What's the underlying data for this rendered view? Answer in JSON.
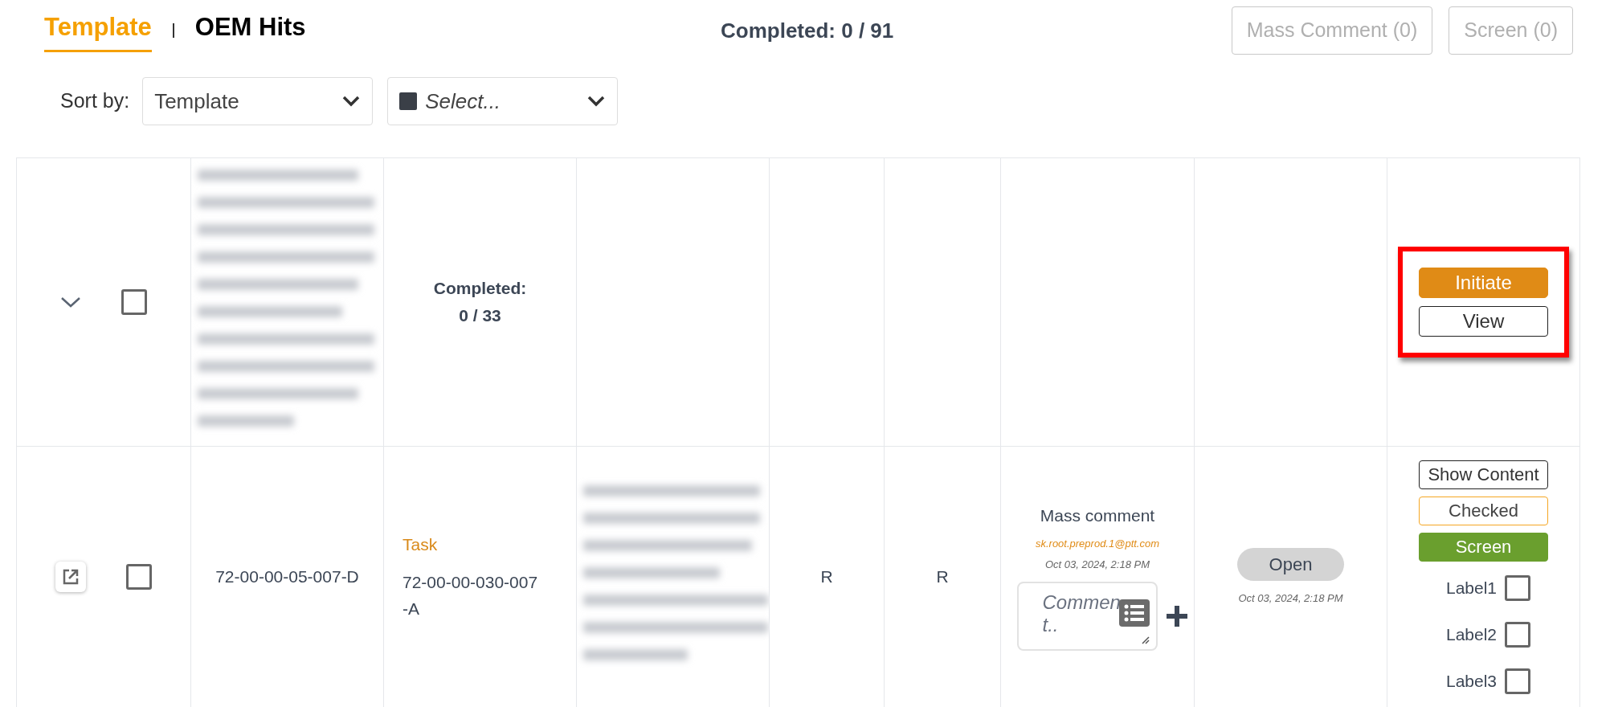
{
  "header": {
    "tabs": [
      {
        "label": "Template",
        "selected": true
      },
      {
        "label": "OEM Hits",
        "selected": false
      }
    ],
    "completed": "Completed: 0 / 91",
    "buttons": [
      {
        "label": "Mass Comment (0)",
        "disabled": true
      },
      {
        "label": "Screen (0)",
        "disabled": true
      }
    ]
  },
  "sort": {
    "label": "Sort by:",
    "selects": [
      {
        "kind": "value",
        "text": "Template"
      },
      {
        "kind": "placeholder",
        "text": "Select..."
      }
    ]
  },
  "rows": [
    {
      "kind": "group",
      "checked": false,
      "completed_label": "Completed:",
      "completed_value": "0 / 33",
      "highlighted": true,
      "actions": [
        {
          "label": "Initiate",
          "kind": "primary"
        },
        {
          "label": "View",
          "kind": "outline"
        }
      ]
    },
    {
      "kind": "task",
      "checked": false,
      "column_2": "72-00-00-05-007-D",
      "type": "Task",
      "number": "72-00-00-030-007-A",
      "column_5": "R",
      "column_6": "R",
      "comment": {
        "title": "Mass comment",
        "author": "sk.root.preprod.1@ptt.com",
        "date": "Oct 03, 2024, 2:18 PM",
        "placeholder": "Comment.."
      },
      "status": {
        "label": "Open",
        "date": "Oct 03, 2024, 2:18 PM"
      },
      "actions": [
        {
          "label": "Show Content",
          "kind": "outline"
        },
        {
          "label": "Checked",
          "kind": "warning"
        },
        {
          "label": "Screen",
          "kind": "success"
        }
      ],
      "labels": [
        {
          "label": "Label1",
          "checked": false
        },
        {
          "label": "Label2",
          "checked": false
        },
        {
          "label": "Label3",
          "checked": false
        }
      ]
    }
  ]
}
